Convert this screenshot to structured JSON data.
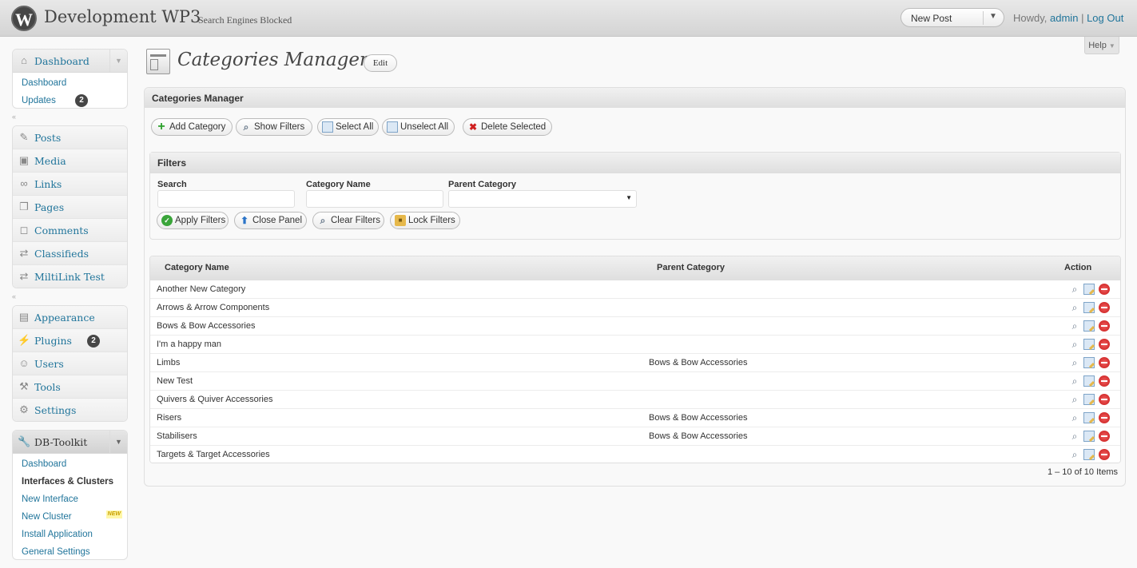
{
  "header": {
    "site_title": "Development WP3",
    "site_note": "Search Engines Blocked",
    "favorite_action": "New Post",
    "howdy_prefix": "Howdy,",
    "user": "admin",
    "separator": "|",
    "logout": "Log Out",
    "help": "Help"
  },
  "sidebar": {
    "dashboard_group": {
      "label": "Dashboard",
      "items": [
        {
          "label": "Dashboard"
        },
        {
          "label": "Updates",
          "badge": "2"
        }
      ]
    },
    "content_group": [
      {
        "label": "Posts",
        "icon": "pin-icon"
      },
      {
        "label": "Media",
        "icon": "media-icon"
      },
      {
        "label": "Links",
        "icon": "link-icon"
      },
      {
        "label": "Pages",
        "icon": "pages-icon"
      },
      {
        "label": "Comments",
        "icon": "comment-icon"
      },
      {
        "label": "Classifieds",
        "icon": "arrows-icon"
      },
      {
        "label": "MiltiLink Test",
        "icon": "arrows-icon"
      }
    ],
    "admin_group": [
      {
        "label": "Appearance",
        "icon": "appearance-icon"
      },
      {
        "label": "Plugins",
        "icon": "plug-icon",
        "badge": "2"
      },
      {
        "label": "Users",
        "icon": "users-icon"
      },
      {
        "label": "Tools",
        "icon": "tools-icon"
      },
      {
        "label": "Settings",
        "icon": "settings-icon"
      }
    ],
    "toolkit_group": {
      "label": "DB-Toolkit",
      "items": [
        {
          "label": "Dashboard"
        },
        {
          "label": "Interfaces & Clusters"
        },
        {
          "label": "New Interface"
        },
        {
          "label": "New Cluster",
          "tag": "NEW"
        },
        {
          "label": "Install Application"
        },
        {
          "label": "General Settings"
        }
      ]
    }
  },
  "page": {
    "title": "Categories Manager",
    "edit_label": "Edit"
  },
  "panel": {
    "title": "Categories Manager",
    "toolbar": {
      "add": "Add Category",
      "show_filters": "Show Filters",
      "select_all": "Select All",
      "unselect_all": "Unselect All",
      "delete_selected": "Delete Selected"
    },
    "filters": {
      "title": "Filters",
      "search_label": "Search",
      "search_value": "",
      "name_label": "Category Name",
      "name_value": "",
      "parent_label": "Parent Category",
      "parent_value": "",
      "apply": "Apply Filters",
      "close": "Close Panel",
      "clear": "Clear Filters",
      "lock": "Lock Filters"
    },
    "table": {
      "columns": [
        "Category Name",
        "Parent Category",
        "Action"
      ],
      "rows": [
        {
          "name": "Another New Category",
          "parent": ""
        },
        {
          "name": "Arrows & Arrow Components",
          "parent": ""
        },
        {
          "name": "Bows & Bow Accessories",
          "parent": ""
        },
        {
          "name": "I'm a happy man",
          "parent": ""
        },
        {
          "name": "Limbs",
          "parent": "Bows & Bow Accessories"
        },
        {
          "name": "New Test",
          "parent": ""
        },
        {
          "name": "Quivers & Quiver Accessories",
          "parent": ""
        },
        {
          "name": "Risers",
          "parent": "Bows & Bow Accessories"
        },
        {
          "name": "Stabilisers",
          "parent": "Bows & Bow Accessories"
        },
        {
          "name": "Targets & Target Accessories",
          "parent": ""
        }
      ]
    },
    "pagination": "1 – 10 of 10 Items"
  }
}
